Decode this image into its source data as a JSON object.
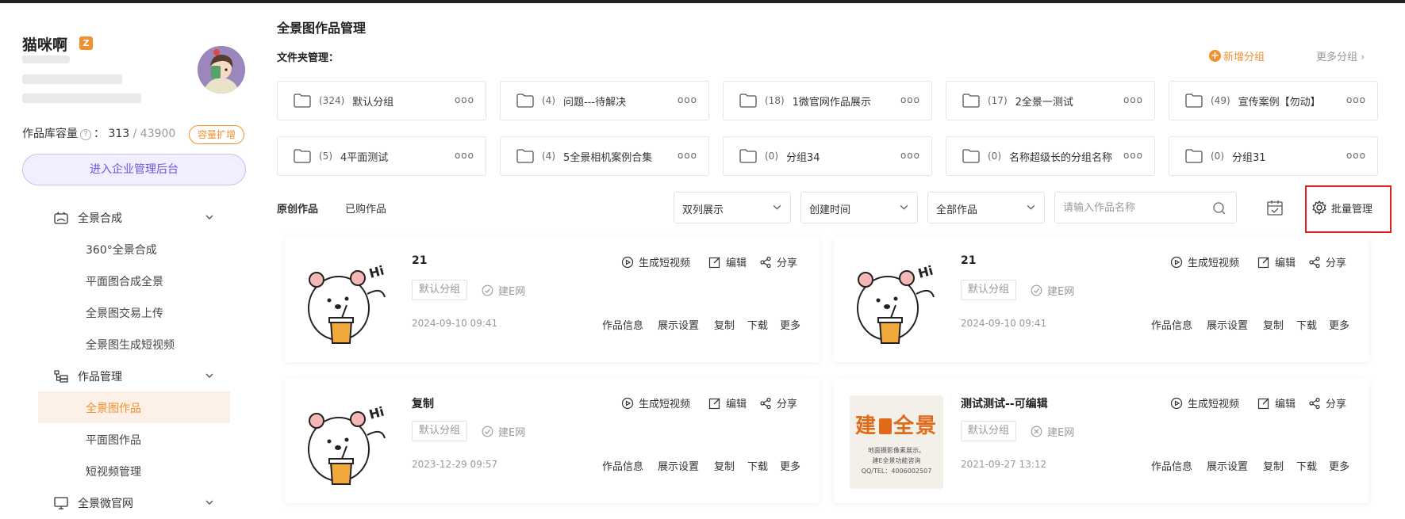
{
  "user": {
    "name": "猫咪啊",
    "vip_badge": "Z",
    "capacity_label": "作品库容量",
    "capacity_used": "313",
    "capacity_total": "/ 43900",
    "expand_label": "容量扩增",
    "enterprise_button": "进入企业管理后台"
  },
  "sidebar": {
    "groups": [
      {
        "label": "全景合成",
        "icon": "panorama-icon",
        "items": [
          {
            "label": "360°全景合成"
          },
          {
            "label": "平面图合成全景"
          },
          {
            "label": "全景图交易上传"
          },
          {
            "label": "全景图生成短视频"
          }
        ]
      },
      {
        "label": "作品管理",
        "icon": "works-tree-icon",
        "items": [
          {
            "label": "全景图作品",
            "active": true
          },
          {
            "label": "平面图作品"
          },
          {
            "label": "短视频管理"
          }
        ]
      },
      {
        "label": "全景微官网",
        "icon": "monitor-icon",
        "items": []
      }
    ]
  },
  "header": {
    "title": "全景图作品管理",
    "folder_title": "文件夹管理：",
    "new_group": "新增分组",
    "more_groups": "更多分组 ›"
  },
  "folders": [
    {
      "count": "(324)",
      "name": "默认分组"
    },
    {
      "count": "(4)",
      "name": "问题---待解决"
    },
    {
      "count": "(18)",
      "name": "1微官网作品展示"
    },
    {
      "count": "(17)",
      "name": "2全景一测试"
    },
    {
      "count": "(49)",
      "name": "宣传案例【勿动】"
    },
    {
      "count": "(5)",
      "name": "4平面测试"
    },
    {
      "count": "(4)",
      "name": "5全景相机案例合集"
    },
    {
      "count": "(0)",
      "name": "分组34"
    },
    {
      "count": "(0)",
      "name": "名称超级长的分组名称"
    },
    {
      "count": "(0)",
      "name": "分组31"
    }
  ],
  "folder_more": "ooo",
  "filters": {
    "tab_original": "原创作品",
    "tab_bought": "已购作品",
    "display_mode": "双列展示",
    "sort": "创建时间",
    "scope": "全部作品",
    "search_placeholder": "请输入作品名称",
    "batch_manage": "批量管理"
  },
  "card_actions": {
    "gen_video": "生成短视频",
    "edit": "编辑",
    "share": "分享",
    "info": "作品信息",
    "display": "展示设置",
    "copy": "复制",
    "download": "下载",
    "more": "更多"
  },
  "works": [
    {
      "title": "21",
      "group": "默认分组",
      "source": "建E网",
      "source_icon": "check-circle-icon",
      "date": "2024-09-10 09:41",
      "thumb": "bear"
    },
    {
      "title": "21",
      "group": "默认分组",
      "source": "建E网",
      "source_icon": "check-circle-icon",
      "date": "2024-09-10 09:41",
      "thumb": "bear"
    },
    {
      "title": "复制",
      "group": "默认分组",
      "source": "建E网",
      "source_icon": "check-circle-icon",
      "date": "2023-12-29 09:57",
      "thumb": "bear"
    },
    {
      "title": "测试测试--可编辑",
      "group": "默认分组",
      "source": "建E网",
      "source_icon": "x-circle-icon",
      "date": "2021-09-27 13:12",
      "thumb": "jiane",
      "thumb_text": {
        "brand": "建",
        "brand2": "全景",
        "line1": "地面摄影像素展示。",
        "line2": "建E全景功能咨询",
        "line3": "QQ/TEL：4006002507"
      }
    }
  ],
  "colors": {
    "accent": "#f0902e",
    "purple": "#6d55e0",
    "highlight_box": "#e02020"
  }
}
